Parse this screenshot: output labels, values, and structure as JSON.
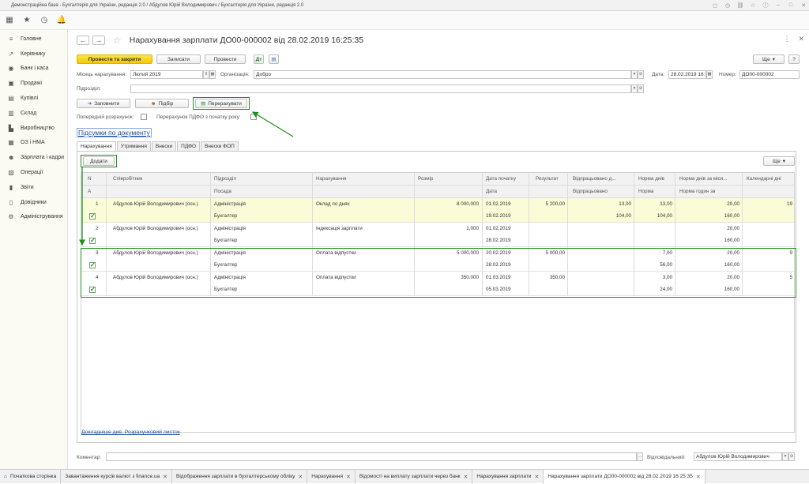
{
  "window": {
    "title": "Демонстраційна база - Бухгалтерія для України, редакція 2.0 / Абдулов Юрій Володимирович / Бухгалтерія для України, редакція 2.0"
  },
  "sidebar": {
    "items": [
      {
        "label": "Головне",
        "icon": "menu-icon"
      },
      {
        "label": "Керівнику",
        "icon": "chart-line-icon"
      },
      {
        "label": "Банк і каса",
        "icon": "bank-icon"
      },
      {
        "label": "Продажі",
        "icon": "cart-icon"
      },
      {
        "label": "Купівлі",
        "icon": "bag-icon"
      },
      {
        "label": "Склад",
        "icon": "warehouse-icon"
      },
      {
        "label": "Виробництво",
        "icon": "factory-icon"
      },
      {
        "label": "ОЗ і НМА",
        "icon": "asset-icon"
      },
      {
        "label": "Зарплата і кадри",
        "icon": "people-icon"
      },
      {
        "label": "Операції",
        "icon": "operations-icon"
      },
      {
        "label": "Звіти",
        "icon": "reports-icon"
      },
      {
        "label": "Довідники",
        "icon": "book-icon"
      },
      {
        "label": "Адміністрування",
        "icon": "gear-icon"
      }
    ]
  },
  "form": {
    "title": "Нарахування зарплати ДО00-000002 від 28.02.2019 16:25:35",
    "buttons": {
      "post_close": "Провести та закрити",
      "save": "Записати",
      "post": "Провести",
      "more": "Ще",
      "help": "?",
      "fill": "Заповнити",
      "select": "Підбір",
      "recalc": "Перерахувати",
      "add": "Додати",
      "more_grid": "Ще"
    },
    "fields": {
      "month_label": "Місяць нарахування:",
      "month_value": "Лютий 2019",
      "org_label": "Організація:",
      "org_value": "Добро",
      "date_label": "Дата:",
      "date_value": "28.02.2019 16:...",
      "number_label": "Номер:",
      "number_value": "ДО00-000002",
      "division_label": "Підрозділ:",
      "division_value": "",
      "prelim_label": "Попередній розрахунок:",
      "recalc_pdfo_label": "Перерахунок ПДФО з початку року:",
      "comment_label": "Коментар:",
      "comment_value": "",
      "responsible_label": "Відповідальний:",
      "responsible_value": "Абдулов Юрій Володимирович"
    },
    "summary_link": "Підсумки по документу",
    "details_link": "Докладніше див. Розрахунковий листок",
    "tabs": [
      "Нарахування",
      "Утримання",
      "Внески",
      "ПДФО",
      "Внески ФОП"
    ]
  },
  "grid": {
    "headers_top": [
      "N",
      "Співробітник",
      "Підрозділ",
      "Нарахування",
      "Розмір",
      "Дата початку",
      "Результат",
      "Відпрацьовано д...",
      "Норма днів",
      "Норма днів за міся...",
      "Календарні дні"
    ],
    "headers_bottom": [
      "А",
      "Посада",
      "Дата",
      "Відпрацьовано",
      "Норма",
      "Норма годин за"
    ],
    "rows": [
      {
        "n": "1",
        "employee": "Абдулов Юрій Володимирович (осн.)",
        "division": "Адміністрація",
        "position": "Бухгалтер",
        "accrual": "Оклад по днях",
        "size": "8 000,000",
        "date_start": "01.02.2019",
        "date_end": "19.02.2019",
        "result": "5 200,00",
        "worked_days": "13,00",
        "worked_hours": "104,00",
        "norm_days": "13,00",
        "norm_hours": "104,00",
        "norm_month_days": "20,00",
        "norm_month_hours": "160,00",
        "calendar_days": "19"
      },
      {
        "n": "2",
        "employee": "Абдулов Юрій Володимирович (осн.)",
        "division": "Адміністрація",
        "position": "Бухгалтер",
        "accrual": "Індексація зарплати",
        "size": "1,000",
        "date_start": "01.02.2019",
        "date_end": "28.02.2019",
        "result": "",
        "worked_days": "",
        "worked_hours": "",
        "norm_days": "",
        "norm_hours": "",
        "norm_month_days": "20,00",
        "norm_month_hours": "160,00",
        "calendar_days": ""
      },
      {
        "n": "3",
        "employee": "Абдулов Юрій Володимирович (осн.)",
        "division": "Адміністрація",
        "position": "Бухгалтер",
        "accrual": "Оплата відпустки",
        "size": "5 000,000",
        "date_start": "20.02.2019",
        "date_end": "28.02.2019",
        "result": "5 000,00",
        "worked_days": "",
        "worked_hours": "",
        "norm_days": "7,00",
        "norm_hours": "56,00",
        "norm_month_days": "20,00",
        "norm_month_hours": "160,00",
        "calendar_days": "9"
      },
      {
        "n": "4",
        "employee": "Абдулов Юрій Володимирович (осн.)",
        "division": "Адміністрація",
        "position": "Бухгалтер",
        "accrual": "Оплата відпустки",
        "size": "350,000",
        "date_start": "01.03.2019",
        "date_end": "05.03.2019",
        "result": "350,00",
        "worked_days": "",
        "worked_hours": "",
        "norm_days": "3,00",
        "norm_hours": "24,00",
        "norm_month_days": "20,00",
        "norm_month_hours": "160,00",
        "calendar_days": "5"
      }
    ]
  },
  "bottom_tabs": [
    {
      "label": "Початкова сторінка",
      "icon": "home-icon"
    },
    {
      "label": "Завантаження курсів валют з finance.ua"
    },
    {
      "label": "Відображення зарплати в бухгалтерському обліку"
    },
    {
      "label": "Нарахування"
    },
    {
      "label": "Відомості на виплату зарплати через банк"
    },
    {
      "label": "Нарахування зарплати"
    },
    {
      "label": "Нарахування зарплати ДО00-000002 від 28.02.2019 16:25:35",
      "active": true
    }
  ],
  "colors": {
    "accent_yellow": "#f4c800",
    "highlight_green": "#1f8f1f",
    "selected_row": "#fbfbd7",
    "link_blue": "#1a4d9c"
  }
}
